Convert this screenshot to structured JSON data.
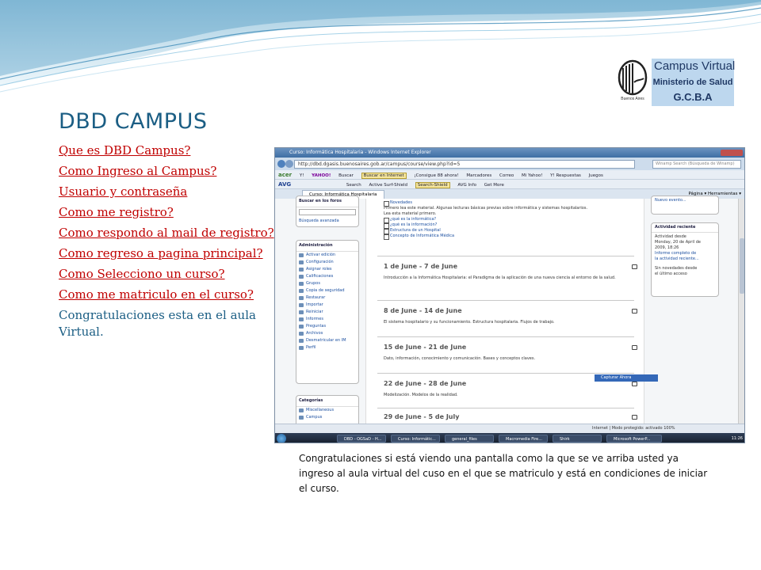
{
  "logo": {
    "emblem_text": "Buenos Aires",
    "brand_line1": "Campus Virtual",
    "brand_line2": "Ministerio de Salud",
    "brand_line3": "G.C.B.A"
  },
  "slide": {
    "title": "DBD CAMPUS",
    "links": [
      "Que es DBD Campus?",
      "Como Ingreso al Campus?",
      "Usuario y contraseña",
      "Como me registro?",
      "Como respondo al mail  de registro?",
      "Como regreso a pagina principal?",
      "Como Selecciono un curso?",
      "Como me matriculo en el curso?"
    ],
    "closing": "Congratulaciones esta en el aula Virtual.",
    "caption": "Congratulaciones si está viendo una pantalla como la que se ve arriba usted ya ingreso al aula virtual del cuso en el que se matriculo y está en condiciones de iniciar el curso."
  },
  "screenshot": {
    "window_title": "Curso: Informática Hospitalaria - Windows Internet Explorer",
    "url": "http://dbd.dgasis.buenosaires.gob.ar/campus/course/view.php?id=5",
    "search_placeholder": "Winamp Search (Búsqueda de Winamp)",
    "toolbar1": [
      "acer",
      "Y!",
      "YAHOO!",
      "Buscar",
      "Buscar en Internet",
      "¡Consigue 88 ahora!",
      "Marcadores",
      "Correo",
      "Mi Yahoo!",
      "Y! Respuestas",
      "Juegos"
    ],
    "toolbar2": [
      "AVG",
      "Search",
      "Active Surf-Shield",
      "Search-Shield",
      "AVG Info",
      "Get More"
    ],
    "tab_label": "Curso: Informática Hospitalaria",
    "tab_tools": "Página ▾   Herramientas ▾",
    "left_blocks": {
      "search_head": "Buscar en los foros",
      "search_adv": "Búsqueda avanzada",
      "admin_head": "Administración",
      "admin_items": [
        "Activar edición",
        "Configuración",
        "Asignar roles",
        "Calificaciones",
        "Grupos",
        "Copia de seguridad",
        "Restaurar",
        "Importar",
        "Reiniciar",
        "Informes",
        "Preguntas",
        "Archivos",
        "Desmatricular en IM",
        "Perfil"
      ],
      "cat_head": "Categorías",
      "cat_items": [
        "Miscellaneous",
        "Campus"
      ]
    },
    "main": {
      "novedades": "Novedades",
      "intro": "Primero lea este material. Algunas lecturas básicas previas sobre informática y sistemas hospitalarios.",
      "intro2": "Lea esta material primero.",
      "resources": [
        "¿qué es la informática?",
        "¿qué es la información?",
        "Estructura de un Hospital",
        "Concepto de Informática Médica"
      ],
      "weeks": [
        {
          "title": "1 de June - 7 de June",
          "desc": "Introducción a la Informática Hospitalaria: el Paradigma de la aplicación de una nueva ciencia al entorno de la salud."
        },
        {
          "title": "8 de June - 14 de June",
          "desc": "El sistema hospitalario y su funcionamiento. Estructura hospitalaria. Flujos de trabajo."
        },
        {
          "title": "15 de June - 21 de June",
          "desc": "Dato, información, conocimiento y comunicación. Bases y conceptos claves."
        },
        {
          "title": "22 de June - 28 de June",
          "desc": "Modelización. Modelos de la realidad."
        },
        {
          "title": "29 de June - 5 de July",
          "desc": ""
        }
      ],
      "tooltip": "Capturar Ahora"
    },
    "right": {
      "events": "Nuevo evento...",
      "recent_head": "Actividad reciente",
      "recent_lines": [
        "Actividad desde",
        "Monday, 20 de April de",
        "2009, 18:26",
        "Informe completo de",
        "la actividad reciente...",
        "",
        "Sin novedades desde",
        "el último acceso"
      ]
    },
    "status_left": "",
    "status_right": "Internet | Modo protegido: activado        100%",
    "taskbar": [
      "DBD - OGSaD - H...",
      "Curso: Informátic...",
      "general_files",
      "Macromedia Fire...",
      "Shirk",
      "Microsoft PowerP..."
    ],
    "clock": "11:26"
  },
  "colors": {
    "title": "#1b5e84",
    "link": "#c00000",
    "brand_bg": "#bdd7ee"
  }
}
